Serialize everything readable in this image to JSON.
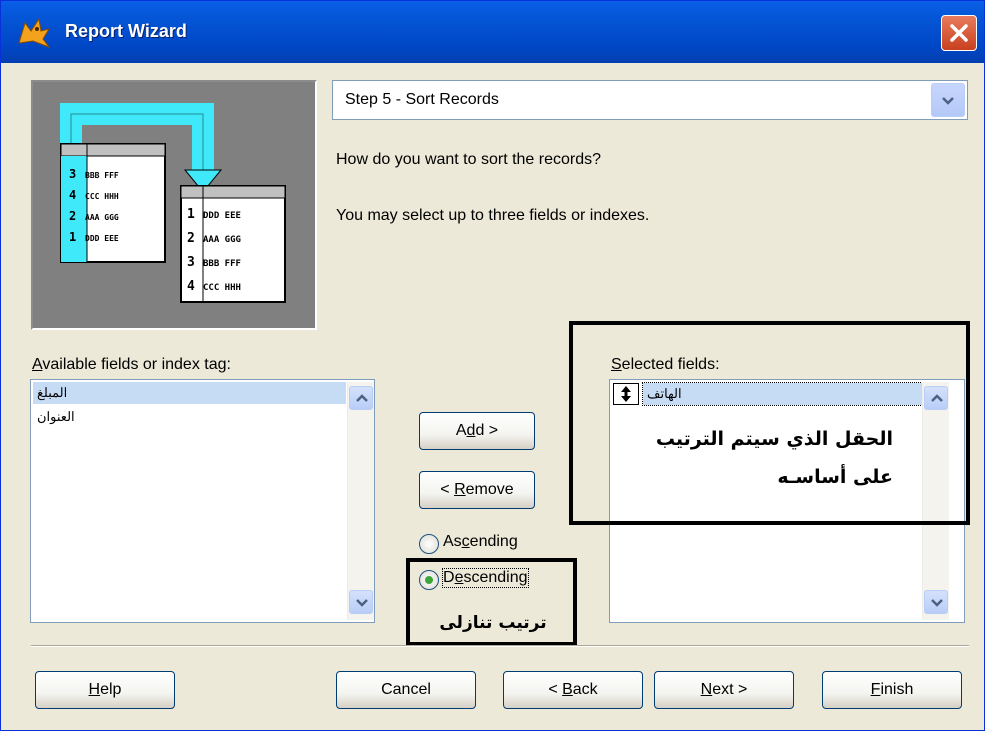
{
  "window": {
    "title": "Report Wizard"
  },
  "step_combo": {
    "value": "Step 5 - Sort Records"
  },
  "instructions": {
    "question": "How do you want to sort the records?",
    "hint": "You may select up to three fields or indexes."
  },
  "available": {
    "label_accel": "A",
    "label_rest": "vailable fields or index tag:",
    "items": [
      "المبلغ",
      "العنوان"
    ]
  },
  "selected": {
    "label_accel": "S",
    "label_rest": "elected fields:",
    "items": [
      "الهاتف"
    ]
  },
  "buttons": {
    "add_pre": "A",
    "add_accel": "d",
    "add_post": "d >",
    "remove_pre": "< ",
    "remove_accel": "R",
    "remove_post": "emove",
    "help_accel": "H",
    "help_rest": "elp",
    "cancel": "Cancel",
    "back_pre": "< ",
    "back_accel": "B",
    "back_post": "ack",
    "next_accel": "N",
    "next_post": "ext >",
    "finish_accel": "F",
    "finish_rest": "inish"
  },
  "sort_order": {
    "ascending_pre": "As",
    "ascending_accel": "c",
    "ascending_post": "ending",
    "descending_pre": "D",
    "descending_accel": "e",
    "descending_post": "scending",
    "selected": "Descending"
  },
  "annotations": {
    "field_note_line1": "الحقل الذي سيتم الترتيب",
    "field_note_line2": "على أساسـه",
    "descending_note": "ترتيب تنازلى"
  },
  "preview": {
    "left_rows": [
      {
        "n": "3",
        "t": "BBB FFF"
      },
      {
        "n": "4",
        "t": "CCC HHH"
      },
      {
        "n": "2",
        "t": "AAA GGG"
      },
      {
        "n": "1",
        "t": "DDD EEE"
      }
    ],
    "right_rows": [
      {
        "n": "1",
        "t": "DDD EEE"
      },
      {
        "n": "2",
        "t": "AAA GGG"
      },
      {
        "n": "3",
        "t": "BBB FFF"
      },
      {
        "n": "4",
        "t": "CCC HHH"
      }
    ]
  },
  "colors": {
    "title_bar": "#0455d5",
    "accent_cyan": "#3fe9f9",
    "selection": "#c6dcf5"
  }
}
